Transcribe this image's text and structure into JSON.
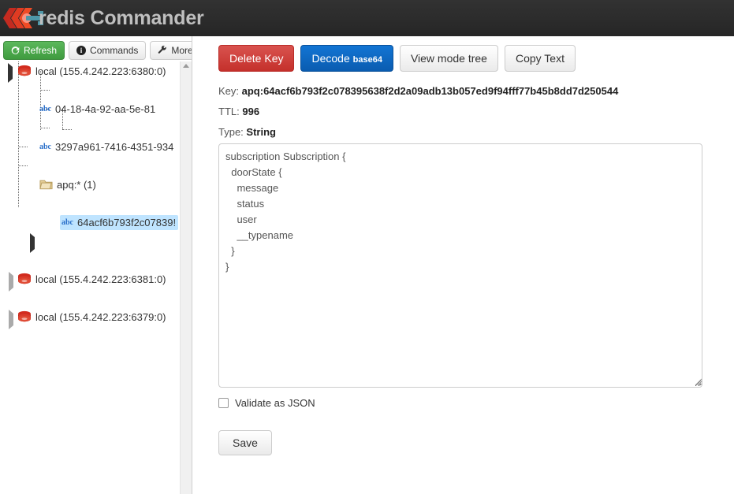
{
  "header": {
    "title": "redis Commander",
    "logo_icon": "redis-logo-icon",
    "background_color": "#2b2b2b",
    "title_color": "#bfbfbf"
  },
  "sidebar": {
    "toolbar": {
      "refresh_label": "Refresh",
      "refresh_icon": "refresh-icon",
      "refresh_color": "#5cb85c",
      "commands_label": "Commands",
      "commands_icon": "info-circle-icon",
      "more_label": "More...",
      "more_icon": "wrench-icon",
      "more_caret_icon": "chevron-down-icon"
    },
    "tree": [
      {
        "label": "local (155.4.242.223:6380:0)",
        "icon": "redis-server-icon",
        "level": 0,
        "expanded": true,
        "selected": false
      },
      {
        "label": "04-18-4a-92-aa-5e-81",
        "icon": "abc-string-icon",
        "level": 1,
        "expanded": null,
        "selected": false
      },
      {
        "label": "3297a961-7416-4351-934",
        "icon": "abc-string-icon",
        "level": 1,
        "expanded": null,
        "selected": false
      },
      {
        "label": "apq:* (1)",
        "icon": "folder-icon",
        "level": 1,
        "expanded": true,
        "selected": false
      },
      {
        "label": "64acf6b793f2c07839!",
        "icon": "abc-string-icon",
        "level": 2,
        "expanded": null,
        "selected": true
      },
      {
        "label": "local (155.4.242.223:6381:0)",
        "icon": "redis-server-icon",
        "level": 0,
        "expanded": false,
        "selected": false
      },
      {
        "label": "local (155.4.242.223:6379:0)",
        "icon": "redis-server-icon",
        "level": 0,
        "expanded": false,
        "selected": false
      }
    ],
    "scrollbar": {
      "up_arrow_icon": "scroll-up-arrow-icon"
    }
  },
  "main": {
    "toolbar": {
      "delete_key_label": "Delete Key",
      "delete_key_color": "#c9302c",
      "decode_label": "Decode",
      "decode_suffix": "base64",
      "decode_color": "#0b63b8",
      "view_mode_label": "View mode tree",
      "copy_text_label": "Copy Text"
    },
    "key_info": {
      "key_caption": "Key:",
      "key_value": "apq:64acf6b793f2c078395638f2d2a09adb13b057ed9f94fff77b45b8dd7d250544",
      "ttl_caption": "TTL:",
      "ttl_value": "996",
      "type_caption": "Type:",
      "type_value": "String"
    },
    "editor": {
      "value": "subscription Subscription {\n  doorState {\n    message\n    status\n    user\n    __typename\n  }\n}"
    },
    "validate": {
      "label": "Validate as JSON",
      "checked": false
    },
    "save_label": "Save"
  }
}
